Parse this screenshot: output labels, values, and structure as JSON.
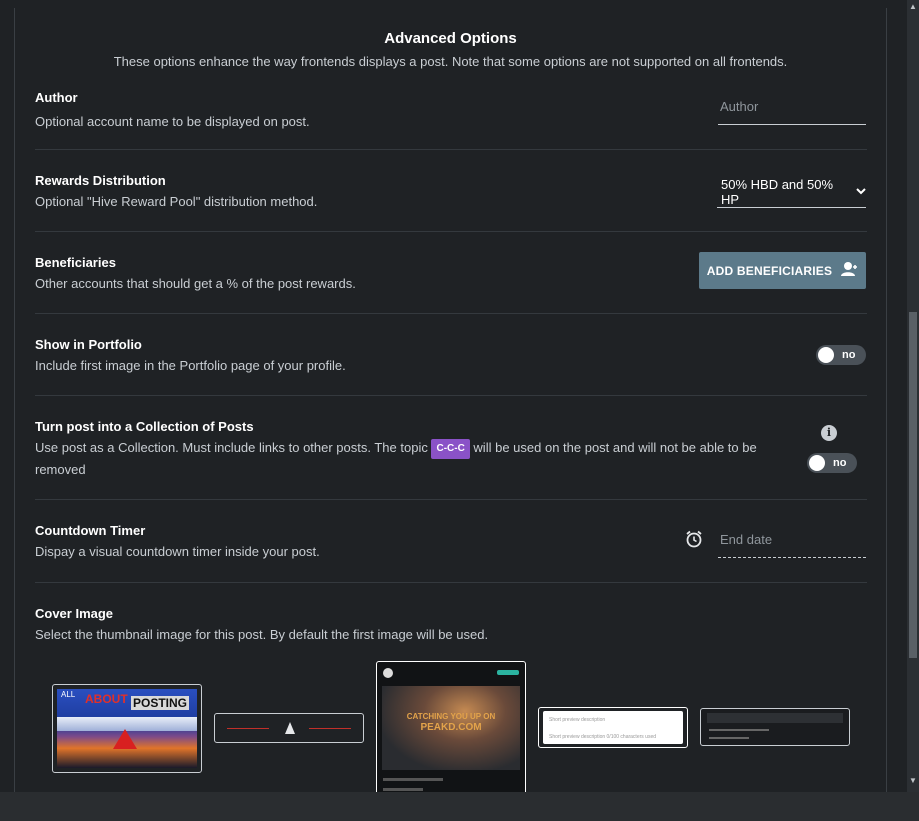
{
  "header": {
    "title": "Advanced Options",
    "subtitle": "These options enhance the way frontends displays a post. Note that some options are not supported on all frontends."
  },
  "author": {
    "title": "Author",
    "desc": "Optional account name to be displayed on post.",
    "placeholder": "Author"
  },
  "rewards": {
    "title": "Rewards Distribution",
    "desc": "Optional \"Hive Reward Pool\" distribution method.",
    "selected": "50% HBD and 50% HP"
  },
  "beneficiaries": {
    "title": "Beneficiaries",
    "desc": "Other accounts that should get a % of the post rewards.",
    "button": "ADD BENEFICIARIES"
  },
  "portfolio": {
    "title": "Show in Portfolio",
    "desc": "Include first image in the Portfolio page of your profile.",
    "toggle": "no"
  },
  "collection": {
    "title": "Turn post into a Collection of Posts",
    "desc_before": "Use post as a Collection. Must include links to other posts. The topic",
    "tag": "C-C-C",
    "desc_after": "will be used on the post and will not be able to be removed",
    "toggle": "no"
  },
  "countdown": {
    "title": "Countdown Timer",
    "desc": "Dispay a visual countdown timer inside your post.",
    "placeholder": "End date"
  },
  "cover": {
    "title": "Cover Image",
    "desc": "Select the thumbnail image for this post. By default the first image will be used.",
    "thumb1": {
      "line1": "ALL",
      "line2": "ABOUT",
      "line3": "POSTING"
    },
    "thumb3": {
      "headline1": "CATCHING YOU UP ON",
      "headline2": "PEAKD.COM"
    },
    "thumb4": {
      "line1": "Short preview description",
      "line2": "Short preview description 0/100 characters used"
    }
  }
}
